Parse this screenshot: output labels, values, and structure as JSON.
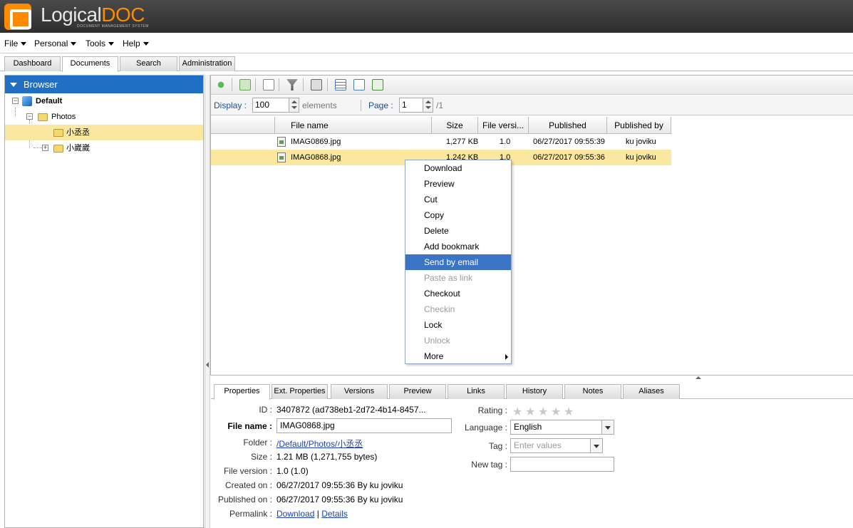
{
  "app": {
    "logo_main": "Logical",
    "logo_accent": "DOC",
    "logo_sub": "DOCUMENT MANAGEMENT SYSTEM",
    "accent_color": "#ff8a00"
  },
  "menu": [
    "File",
    "Personal",
    "Tools",
    "Help"
  ],
  "top_tabs": [
    "Dashboard",
    "Documents",
    "Search",
    "Administration"
  ],
  "browser": {
    "title": "Browser",
    "tree": {
      "root": "Default",
      "folder": "Photos",
      "children": [
        "小丞丞",
        "小崴崴"
      ]
    }
  },
  "pagination": {
    "display_label": "Display :",
    "display_value": "100",
    "elements_label": "elements",
    "page_label": "Page :",
    "page_value": "1",
    "page_total": "/1"
  },
  "grid": {
    "columns": [
      "File name",
      "Size",
      "File versi...",
      "Published",
      "Published by"
    ],
    "rows": [
      {
        "name": "IMAG0869.jpg",
        "size": "1,277 KB",
        "version": "1.0",
        "published": "06/27/2017 09:55:39",
        "by": "ku joviku"
      },
      {
        "name": "IMAG0868.jpg",
        "size": "1,242 KB",
        "version": "1.0",
        "published": "06/27/2017 09:55:36",
        "by": "ku joviku"
      }
    ]
  },
  "context_menu": [
    {
      "label": "Download"
    },
    {
      "label": "Preview"
    },
    {
      "label": "Cut"
    },
    {
      "label": "Copy"
    },
    {
      "label": "Delete"
    },
    {
      "label": "Add bookmark"
    },
    {
      "label": "Send by email",
      "state": "highlighted"
    },
    {
      "label": "Paste as link",
      "state": "disabled"
    },
    {
      "label": "Checkout"
    },
    {
      "label": "Checkin",
      "state": "disabled"
    },
    {
      "label": "Lock"
    },
    {
      "label": "Unlock",
      "state": "disabled"
    },
    {
      "label": "More",
      "submenu": true
    }
  ],
  "bottom_tabs": [
    "Properties",
    "Ext. Properties",
    "Versions",
    "Preview",
    "Links",
    "History",
    "Notes",
    "Aliases"
  ],
  "properties": {
    "id_label": "ID :",
    "id_value": "3407872 (ad738eb1-2d72-4b14-8457...",
    "filename_label": "File name :",
    "filename_value": "IMAG0868.jpg",
    "folder_label": "Folder :",
    "folder_value": "/Default/Photos/小丞丞",
    "size_label": "Size :",
    "size_value": "1.21 MB (1,271,755 bytes)",
    "version_label": "File version :",
    "version_value": "1.0 (1.0)",
    "created_label": "Created on :",
    "created_value": "06/27/2017 09:55:36 By ku joviku",
    "published_label": "Published on :",
    "published_value": "06/27/2017 09:55:36 By ku joviku",
    "permalink_label": "Permalink :",
    "permalink_download": "Download",
    "permalink_sep": "|",
    "permalink_details": "Details",
    "rating_label": "Rating :",
    "rating_stars": 0,
    "rating_max": 5,
    "language_label": "Language :",
    "language_value": "English",
    "tag_label": "Tag :",
    "tag_placeholder": "Enter values",
    "newtag_label": "New tag :",
    "newtag_value": ""
  }
}
